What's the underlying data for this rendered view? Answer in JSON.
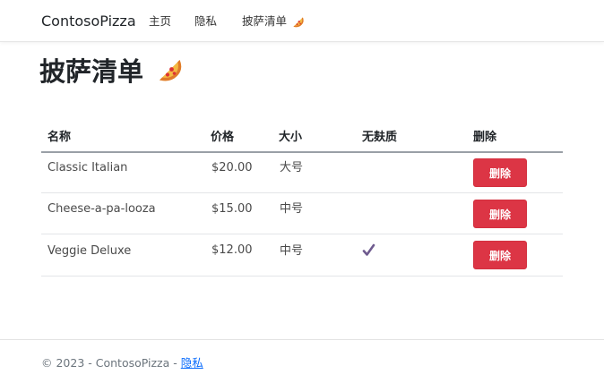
{
  "nav": {
    "brand": "ContosoPizza",
    "home": "主页",
    "privacy": "隐私",
    "pizza_list": "披萨清单"
  },
  "page": {
    "title": "披萨清单"
  },
  "table": {
    "headers": [
      "名称",
      "价格",
      "大小",
      "无麸质",
      "删除"
    ],
    "rows": [
      {
        "name": "Classic Italian",
        "price": "$20.00",
        "size": "大号",
        "gluten_free": false,
        "delete_label": "删除"
      },
      {
        "name": "Cheese-a-pa-looza",
        "price": "$15.00",
        "size": "中号",
        "gluten_free": false,
        "delete_label": "删除"
      },
      {
        "name": "Veggie Deluxe",
        "price": "$12.00",
        "size": "中号",
        "gluten_free": true,
        "delete_label": "删除"
      }
    ]
  },
  "footer": {
    "copyright": "© 2023 - ContosoPizza - ",
    "privacy_link": "隐私"
  },
  "icons": {
    "pizza": "pizza-icon",
    "check": "check-icon"
  },
  "colors": {
    "danger": "#dc3545",
    "check": "#6f5b8f",
    "link": "#0d6efd"
  }
}
